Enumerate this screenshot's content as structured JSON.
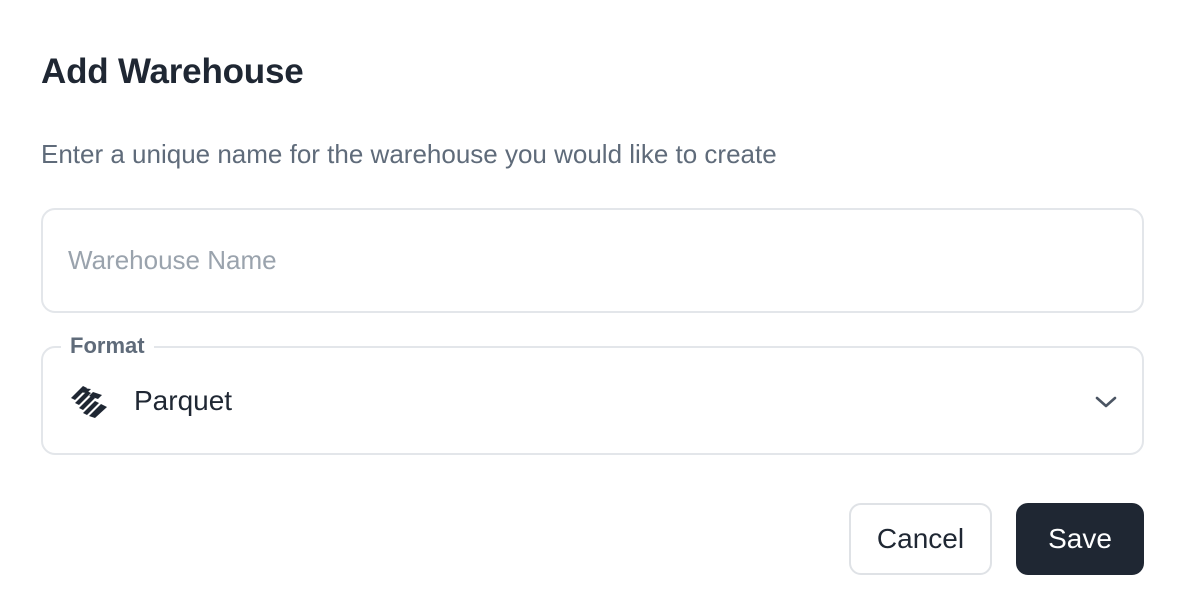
{
  "dialog": {
    "title": "Add Warehouse",
    "subtitle": "Enter a unique name for the warehouse you would like to create"
  },
  "name_field": {
    "value": "",
    "placeholder": "Warehouse Name"
  },
  "format_field": {
    "label": "Format",
    "selected_value": "Parquet",
    "icon": "parquet-logo-icon"
  },
  "actions": {
    "cancel_label": "Cancel",
    "save_label": "Save"
  },
  "colors": {
    "primary_button": "#1f2733",
    "border": "#e3e6ea",
    "muted_text": "#5f6b7a",
    "placeholder": "#9aa3ad"
  }
}
